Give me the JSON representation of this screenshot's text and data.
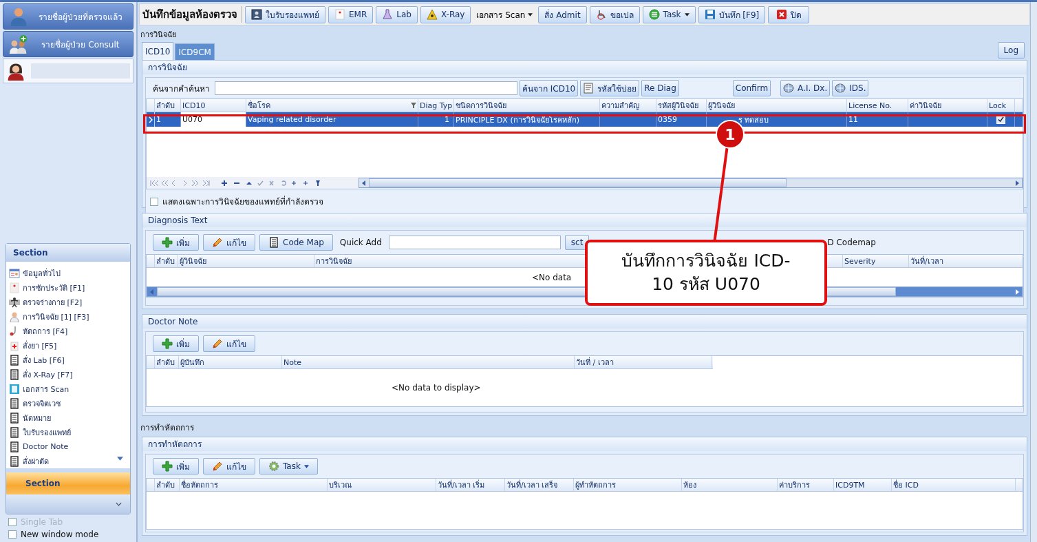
{
  "sidebar": {
    "nav_buttons": [
      {
        "label": "รายชื่อผู้ป่วยที่ตรวจแล้ว",
        "kind": "doctor"
      },
      {
        "label": "รายชื่อผู้ป่วย Consult",
        "kind": "group"
      }
    ],
    "section_panel": {
      "title": "Section",
      "items": [
        {
          "label": "ข้อมูลทั่วไป",
          "kind": "profile"
        },
        {
          "label": "การซักประวัติ [F1]",
          "kind": "page"
        },
        {
          "label": "ตรวจร่างกาย  [F2]",
          "kind": "body"
        },
        {
          "label": "การวินิจฉัย [1] [F3]",
          "kind": "doctor"
        },
        {
          "label": "หัตถการ [F4]",
          "kind": "stethoscope"
        },
        {
          "label": "สั่งยา [F5]",
          "kind": "medicine"
        },
        {
          "label": "สั่ง Lab  [F6]",
          "kind": "list"
        },
        {
          "label": "สั่ง X-Ray  [F7]",
          "kind": "list"
        },
        {
          "label": "เอกสาร Scan",
          "kind": "scan"
        },
        {
          "label": "ตรวจจิตเวช",
          "kind": "list"
        },
        {
          "label": "นัดหมาย",
          "kind": "list"
        },
        {
          "label": "ใบรับรองแพทย์",
          "kind": "list"
        },
        {
          "label": "Doctor Note",
          "kind": "list"
        },
        {
          "label": "สั่งผ่าตัด",
          "kind": "list"
        }
      ],
      "footer_title": "Section"
    },
    "options": [
      {
        "label": "Single Tab",
        "checked": false,
        "disabled": true
      },
      {
        "label": "New window mode",
        "checked": false,
        "disabled": false
      }
    ]
  },
  "toolbar": {
    "title": "บันทึกข้อมูลห้องตรวจ",
    "buttons": [
      {
        "label": "ใบรับรองแพทย์",
        "kind": "cert"
      },
      {
        "label": "EMR",
        "kind": "emr"
      },
      {
        "label": "Lab",
        "kind": "lab"
      },
      {
        "label": "X-Ray",
        "kind": "xray"
      },
      {
        "label": "เอกสาร Scan",
        "kind": "menu"
      },
      {
        "label": "สั่ง Admit",
        "kind": "plain"
      },
      {
        "label": "ขอเปล",
        "kind": "wheel"
      },
      {
        "label": "Task",
        "kind": "task"
      },
      {
        "label": "บันทึก [F9]",
        "kind": "save"
      },
      {
        "label": "ปิด",
        "kind": "close"
      }
    ]
  },
  "section_label": "การวินิจฉัย",
  "tabs": [
    {
      "label": "ICD10",
      "selected": true
    },
    {
      "label": "ICD9CM",
      "selected": false
    }
  ],
  "log_button": "Log",
  "diagnosis_panel": {
    "title": "การวินิจฉัย",
    "search_label": "ค้นจากคำค้นหา",
    "buttons": [
      {
        "label": "ค้นจาก ICD10",
        "kind": "plain"
      },
      {
        "label": "รหัสใช้บ่อย",
        "kind": "memo"
      },
      {
        "label": "Re Diag",
        "kind": "plain"
      },
      {
        "label": "Confirm",
        "kind": "plain"
      },
      {
        "label": "A.I. Dx.",
        "kind": "monitor"
      },
      {
        "label": "IDS.",
        "kind": "monitor"
      }
    ],
    "columns": [
      "ลำดับ",
      "ICD10",
      "ชื่อโรค",
      "Diag Typ",
      "ชนิดการวินิจฉัย",
      "ความสำคัญ",
      "รหัสผู้วินิจฉัย",
      "ผู้วินิจฉัย",
      "License No.",
      "ค่าวินิจฉัย",
      "Lock"
    ],
    "rows": [
      {
        "no": "1",
        "icd10": "U070",
        "name": "Vaping related disorder",
        "diag_type": "1",
        "dx_type": "PRINCIPLE DX (การวินิจฉัยโรคหลัก)",
        "doctor_code": "0359",
        "doctor": "ร ทดสอบ",
        "license": "11",
        "lock": true,
        "selected": true
      }
    ],
    "filter_option": {
      "label": "แสดงเฉพาะการวินิจฉัยของแพทย์ที่กำลังตรวจ",
      "checked": false
    }
  },
  "diagnosis_text": {
    "title": "Diagnosis Text",
    "buttons": [
      {
        "label": "เพิ่ม",
        "kind": "plus"
      },
      {
        "label": "แก้ไข",
        "kind": "pencil"
      },
      {
        "label": "Code Map",
        "kind": "list"
      }
    ],
    "quick_add_label": "Quick Add",
    "sct_button": "sct",
    "codemap_label": "D Codemap",
    "columns": [
      "ลำดับ",
      "ผู้วินิจฉัย",
      "การวินิจฉัย",
      "Severity",
      "วันที่/เวลา"
    ],
    "empty_text": "<No data"
  },
  "doctor_note": {
    "title": "Doctor Note",
    "buttons": [
      {
        "label": "เพิ่ม",
        "kind": "plus"
      },
      {
        "label": "แก้ไข",
        "kind": "pencil"
      }
    ],
    "columns": [
      "ลำดับ",
      "ผู้บันทึก",
      "Note",
      "วันที่ / เวลา"
    ],
    "empty_text": "<No data to display>"
  },
  "procedure_label": "การทำหัตถการ",
  "procedures": {
    "title": "การทำหัตถการ",
    "buttons": [
      {
        "label": "เพิ่ม",
        "kind": "plus"
      },
      {
        "label": "แก้ไข",
        "kind": "pencil"
      },
      {
        "label": "Task",
        "kind": "gear"
      }
    ],
    "columns": [
      "ลำดับ",
      "ชื่อหัตถการ",
      "บริเวณ",
      "วันที่/เวลา เริ่ม",
      "วันที่/เวลา เสร็จ",
      "ผู้ทำหัตถการ",
      "ห้อง",
      "ค่าบริการ",
      "ICD9TM",
      "ชื่อ ICD"
    ]
  },
  "callout": {
    "number": "1",
    "text": "บันทึกการวินิจฉัย ICD-10 รหัส U070"
  }
}
